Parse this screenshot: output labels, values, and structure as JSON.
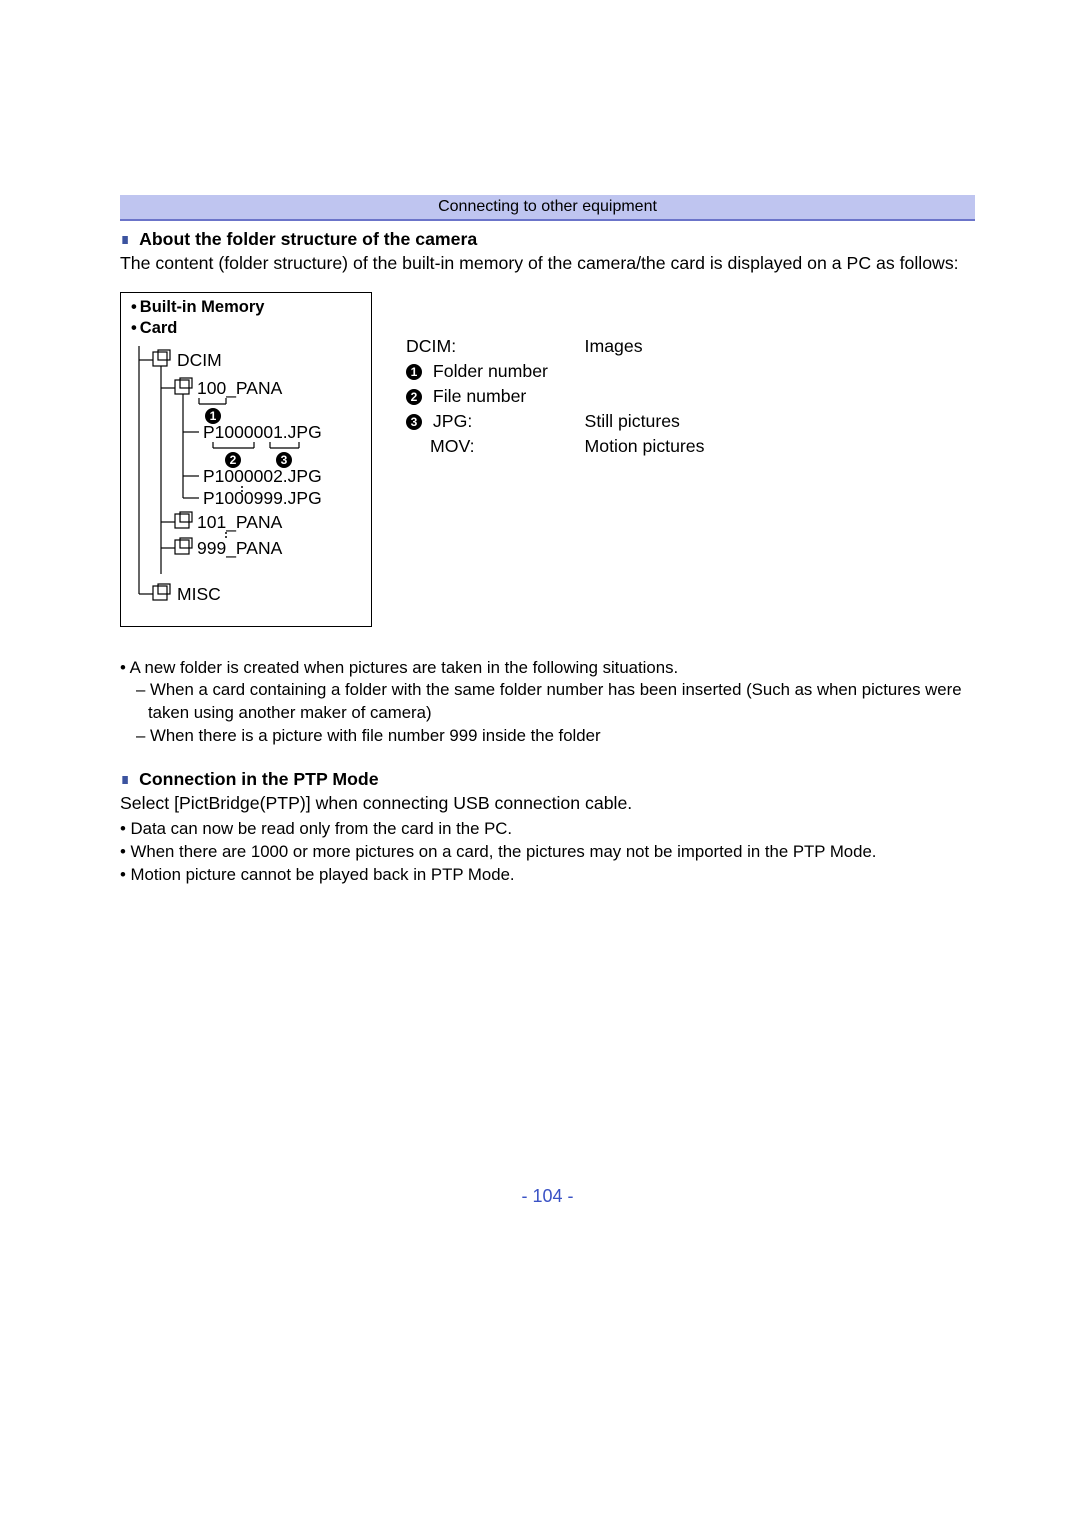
{
  "banner": "Connecting to other equipment",
  "section1": {
    "title": "About the folder structure of the camera",
    "intro": "The content (folder structure) of the built-in memory of the camera/the card is displayed on a PC as follows:"
  },
  "diagram": {
    "head1": "Built-in Memory",
    "head2": "Card",
    "root": "DCIM",
    "folder1": "100_PANA",
    "file1": "P1000001.JPG",
    "file2": "P1000002.JPG",
    "file3": "P1000999.JPG",
    "folder2": "101_PANA",
    "folder3": "999_PANA",
    "misc": "MISC",
    "marks": {
      "m1": "1",
      "m2": "2",
      "m3": "3"
    }
  },
  "legend": {
    "dcim_l": "DCIM:",
    "dcim_r": "Images",
    "r1": "Folder number",
    "r2": "File number",
    "r3_l": "JPG:",
    "r3_r": "Still pictures",
    "r4_l": "MOV:",
    "r4_r": "Motion pictures",
    "n1": "1",
    "n2": "2",
    "n3": "3"
  },
  "notes1": {
    "n1": "A new folder is created when pictures are taken in the following situations.",
    "n2": "When a card containing a folder with the same folder number has been inserted (Such as when pictures were taken using another maker of camera)",
    "n3": "When there is a picture with file number 999 inside the folder"
  },
  "section2": {
    "title": "Connection in the PTP Mode",
    "intro": "Select [PictBridge(PTP)] when connecting USB connection cable.",
    "b1": "Data can now be read only from the card in the PC.",
    "b2": "When there are 1000 or more pictures on a card, the pictures may not be imported in the PTP Mode.",
    "b3": "Motion picture cannot be played back in PTP Mode."
  },
  "page_number": "- 104 -"
}
